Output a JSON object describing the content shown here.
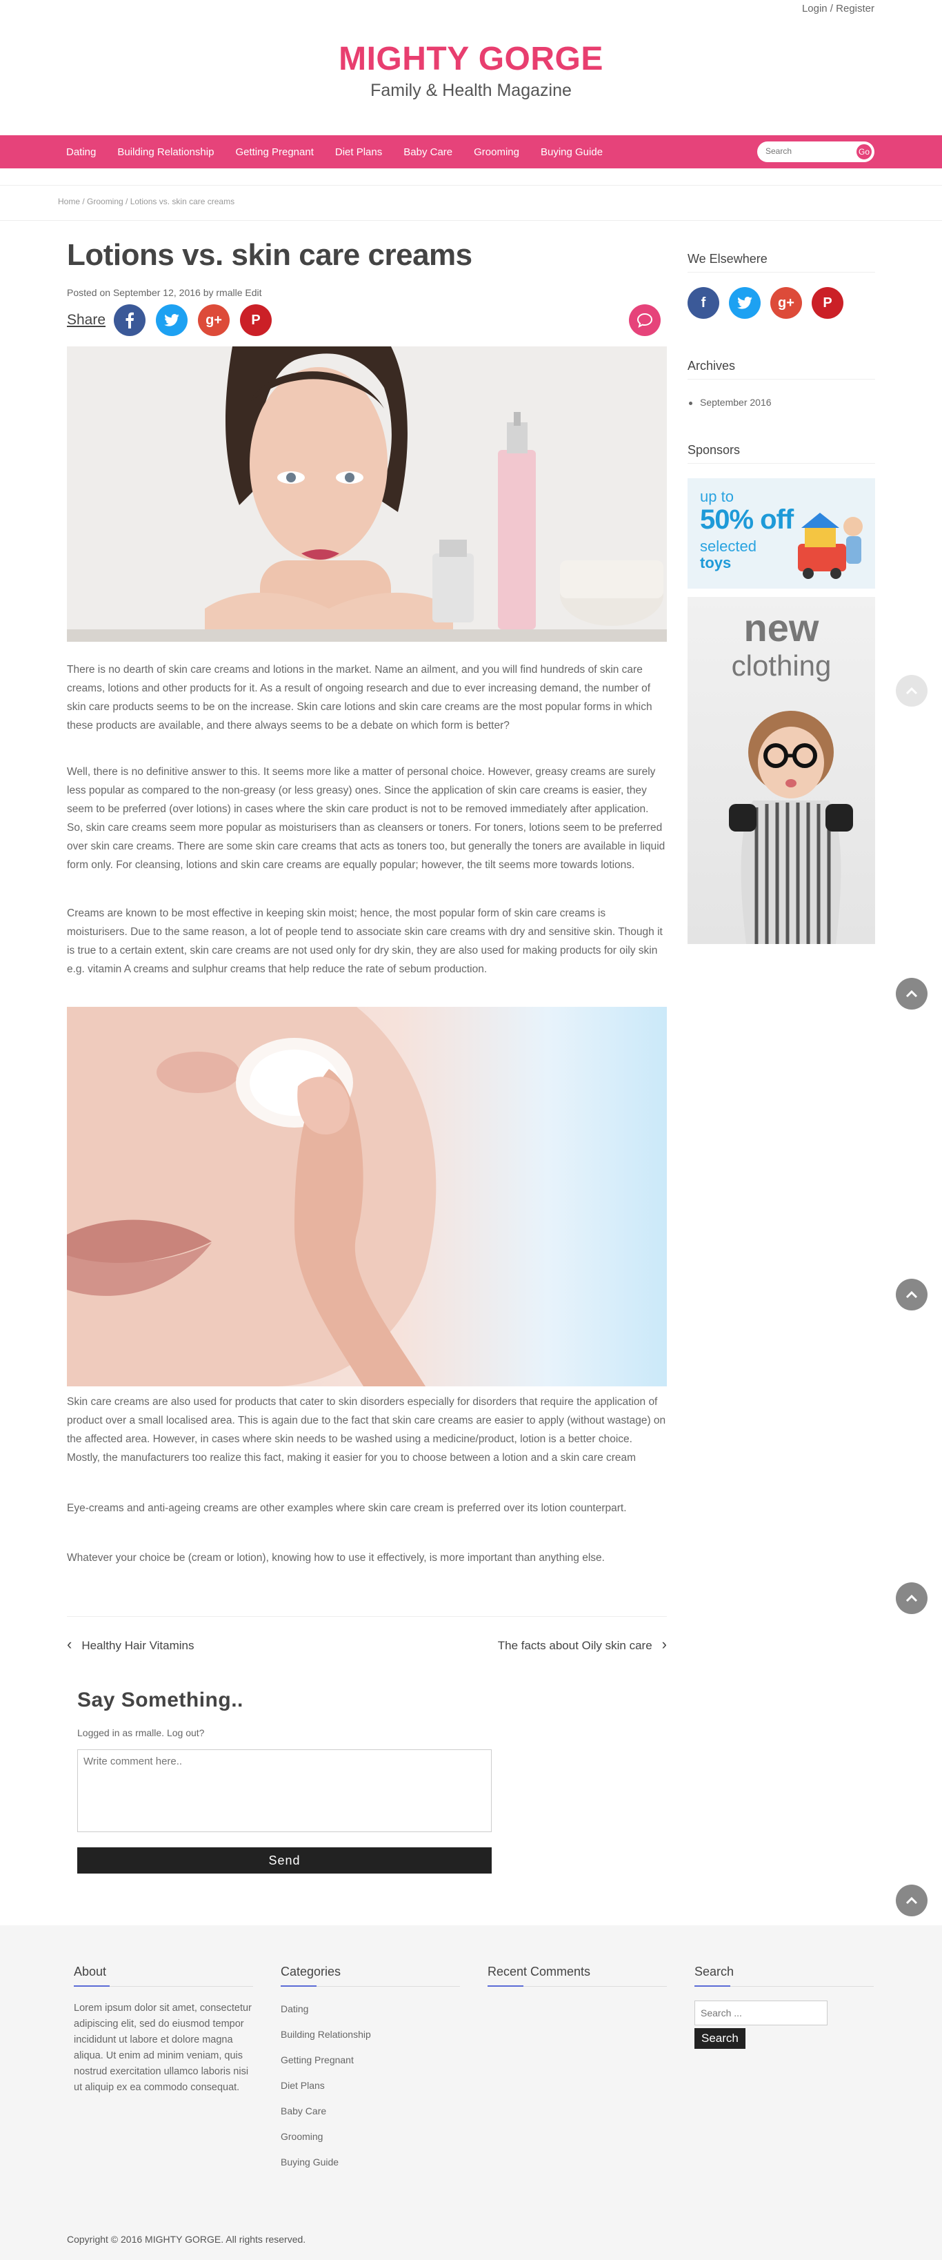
{
  "header": {
    "login_register": "Login / Register",
    "site_title": "MIGHTY GORGE",
    "tagline": "Family & Health Magazine"
  },
  "nav": {
    "items": [
      {
        "label": "Dating"
      },
      {
        "label": "Building Relationship"
      },
      {
        "label": "Getting Pregnant"
      },
      {
        "label": "Diet Plans"
      },
      {
        "label": "Baby Care"
      },
      {
        "label": "Grooming"
      },
      {
        "label": "Buying Guide"
      }
    ],
    "search_placeholder": "Search",
    "go_label": "Go"
  },
  "breadcrumb": "Home / Grooming / Lotions vs. skin care creams",
  "post": {
    "title": "Lotions vs. skin care creams",
    "meta": "Posted on September 12, 2016 by rmalle Edit",
    "share_label": "Share",
    "paragraphs": [
      "There is no dearth of skin care creams and lotions in the market. Name an ailment, and you will find hundreds of skin care creams, lotions and other products for it. As a result of ongoing research and due to ever increasing demand, the number of skin care products seems to be on the increase. Skin care lotions and skin care creams are the most popular forms in which these products are available, and there always seems to be a debate on which form is better?",
      "Well, there is no definitive answer to this. It seems more like a matter of personal choice. However, greasy creams are surely less popular as compared to the non-greasy (or less greasy) ones. Since the application of skin care creams is easier, they seem to be preferred (over lotions) in cases where the skin care product is not to be removed immediately after application. So, skin care creams seem more popular as moisturisers than as cleansers or toners. For toners, lotions seem to be preferred over skin care creams. There are some skin care creams that acts as toners too, but generally the toners are available in liquid form only. For cleansing, lotions and skin care creams are equally popular; however, the tilt seems more towards lotions.",
      "Creams are known to be most effective in keeping skin moist; hence, the most popular form of skin care creams is moisturisers. Due to the same reason, a lot of people tend to associate skin care creams with dry and sensitive skin. Though it is true to a certain extent, skin care creams are not used only for dry skin, they are also used for making products for oily skin e.g. vitamin A creams and sulphur creams that help reduce the rate of sebum production.",
      "Skin care creams are also used for products that cater to skin disorders especially for disorders that require the application of product over a small localised area. This is again due to the fact that skin care creams are easier to apply (without wastage) on the affected area. However, in cases where skin needs to be washed using a medicine/product, lotion is a better choice. Mostly, the manufacturers too realize this fact, making it easier for you to choose between a lotion and a skin care cream",
      "Eye-creams and anti-ageing creams are other examples where skin care cream is preferred over its lotion counterpart.",
      "Whatever your choice be (cream or lotion), knowing how to use it effectively, is more important than anything else."
    ],
    "prev_link": "Healthy Hair Vitamins",
    "next_link": "The facts about Oily skin care"
  },
  "comments": {
    "title": "Say Something..",
    "logged_in": "Logged in as rmalle. Log out?",
    "placeholder": "Write comment here..",
    "send_label": "Send"
  },
  "sidebar": {
    "elsewhere_title": "We Elsewhere",
    "archives_title": "Archives",
    "archive_items": [
      "September 2016"
    ],
    "sponsors_title": "Sponsors",
    "ad1": {
      "line1": "up to",
      "line2": "50% off",
      "line3": "selected",
      "line4": "toys"
    },
    "ad2": {
      "line1": "new",
      "line2": "clothing"
    }
  },
  "footer": {
    "about_title": "About",
    "about_text": "Lorem ipsum dolor sit amet, consectetur adipiscing elit, sed do eiusmod tempor incididunt ut labore et dolore magna aliqua. Ut enim ad minim veniam, quis nostrud exercitation ullamco laboris nisi ut aliquip ex ea commodo consequat.",
    "categories_title": "Categories",
    "categories": [
      "Dating",
      "Building Relationship",
      "Getting Pregnant",
      "Diet Plans",
      "Baby Care",
      "Grooming",
      "Buying Guide"
    ],
    "recent_comments_title": "Recent Comments",
    "search_title": "Search",
    "search_placeholder": "Search ...",
    "search_button": "Search",
    "copyright": "Copyright © 2016 MIGHTY GORGE. All rights reserved."
  },
  "colors": {
    "brand": "#e83e6f",
    "nav_bg": "#e6437a",
    "facebook": "#3b5998",
    "twitter": "#1da1f2",
    "google_plus": "#dd4b39",
    "pinterest": "#cb2027"
  }
}
